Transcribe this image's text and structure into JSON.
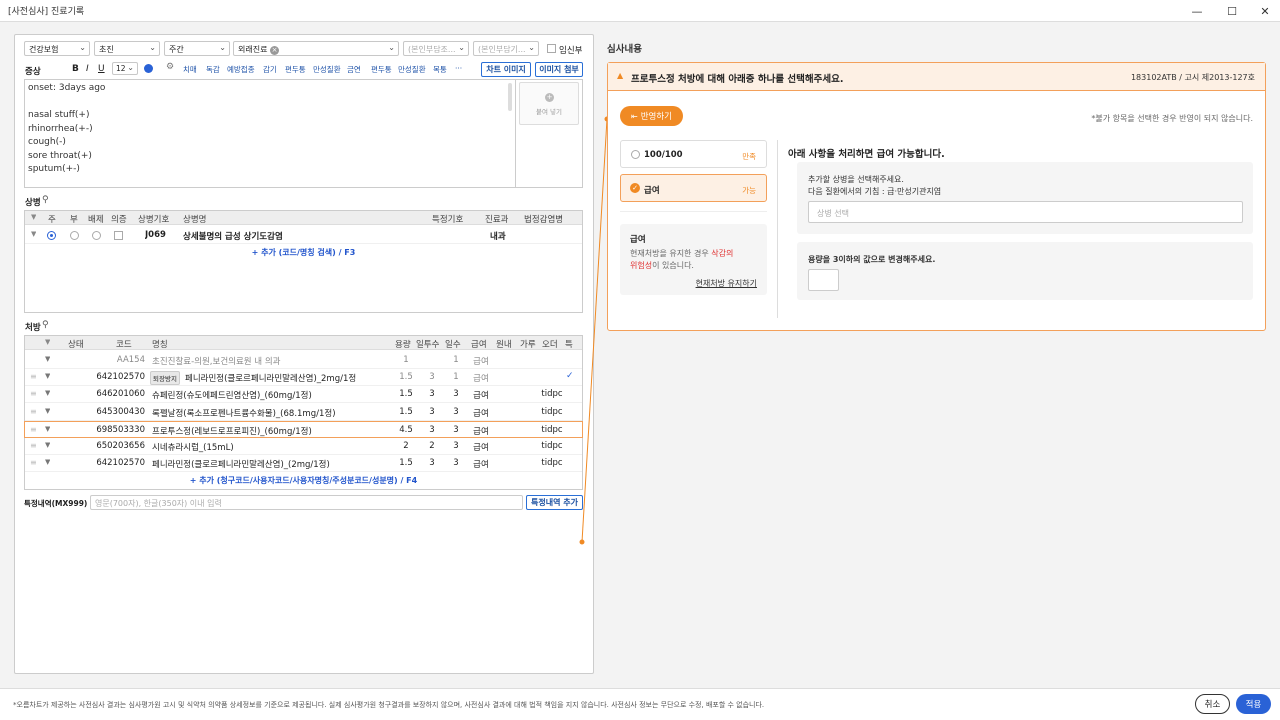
{
  "window": {
    "title": "[사전심사] 진료기록"
  },
  "top_selects": {
    "insurance": "건강보험",
    "visit_type": "초진",
    "time": "주간",
    "care_type": "외래진료",
    "copay1_placeholder": "(본인부담조...",
    "copay2_placeholder": "(본인부담기...",
    "pregnant_label": "임신부"
  },
  "symptom": {
    "label": "증상",
    "font_size": "12",
    "quick_tags": [
      "치매",
      "독감",
      "예방접종",
      "감기",
      "편두통",
      "만성질환",
      "금연",
      "편두통",
      "만성질환",
      "복통",
      "···"
    ],
    "chart_image_btn": "차트 이미지",
    "image_attach_btn": "이미지 첨부",
    "paste_label": "붙여 넣기",
    "text_lines": [
      "onset: 3days ago",
      "",
      "nasal stuff(+)",
      "rhinorrhea(+-)",
      "cough(-)",
      "sore throat(+)",
      "sputum(+-)"
    ]
  },
  "diagnosis": {
    "label": "상병",
    "headers": {
      "main": "주",
      "sub": "부",
      "exclude": "배제",
      "suspect": "의증",
      "code": "상병기호",
      "name": "상병명",
      "special": "특정기호",
      "dept": "진료과",
      "legal": "법정감염병"
    },
    "rows": [
      {
        "code": "J069",
        "name": "상세불명의 급성 상기도감염",
        "dept": "내과"
      }
    ],
    "add_link": "+ 추가 (코드/명칭 검색) / F3"
  },
  "prescription": {
    "label": "처방",
    "headers": {
      "status": "상태",
      "code": "코드",
      "name": "명칭",
      "dose": "용량",
      "times": "일투수",
      "days": "일수",
      "pay": "급여",
      "inout": "원내",
      "powder": "가루",
      "order": "오더",
      "special": "특"
    },
    "rows": [
      {
        "code": "AA154",
        "name": "초진진찰료-의원,보건의료원 내 의과",
        "dose": "1",
        "times": "",
        "days": "1",
        "pay": "급여",
        "order": "",
        "tag": "",
        "grey": true,
        "check": false,
        "highlight": false
      },
      {
        "code": "642102570",
        "name": "페니라민정(클로르페니라민말레산염)_2mg/1정",
        "dose": "1.5",
        "times": "3",
        "days": "1",
        "pay": "급여",
        "order": "",
        "tag": "퇴장방지",
        "grey": false,
        "check": true,
        "highlight": false,
        "greyvals": true
      },
      {
        "code": "646201060",
        "name": "슈페린정(슈도에페드린염산염)_(60mg/1정)",
        "dose": "1.5",
        "times": "3",
        "days": "3",
        "pay": "급여",
        "order": "tidpc",
        "tag": "",
        "grey": false,
        "check": false,
        "highlight": false
      },
      {
        "code": "645300430",
        "name": "록펠날정(록소프로펜나트륨수화물)_(68.1mg/1정)",
        "dose": "1.5",
        "times": "3",
        "days": "3",
        "pay": "급여",
        "order": "tidpc",
        "tag": "",
        "grey": false,
        "check": false,
        "highlight": false
      },
      {
        "code": "698503330",
        "name": "프로투스정(레보드로프로피진)_(60mg/1정)",
        "dose": "4.5",
        "times": "3",
        "days": "3",
        "pay": "급여",
        "order": "tidpc",
        "tag": "",
        "grey": false,
        "check": false,
        "highlight": true
      },
      {
        "code": "650203656",
        "name": "시네츄라시럽_(15mL)",
        "dose": "2",
        "times": "2",
        "days": "3",
        "pay": "급여",
        "order": "tidpc",
        "tag": "",
        "grey": false,
        "check": false,
        "highlight": false
      },
      {
        "code": "642102570",
        "name": "페니라민정(클로르페니라민말레산염)_(2mg/1정)",
        "dose": "1.5",
        "times": "3",
        "days": "3",
        "pay": "급여",
        "order": "tidpc",
        "tag": "",
        "grey": false,
        "check": false,
        "highlight": false
      }
    ],
    "add_link": "+ 추가 (청구코드/사용자코드/사용자명칭/주성분코드/성분명) / F4"
  },
  "special_record": {
    "label": "특정내역(MX999)",
    "placeholder": "영문(700자), 한글(350자) 이내 입력",
    "add_btn": "특정내역 추가"
  },
  "review": {
    "title": "심사내용",
    "banner_text": "프로투스정 처방에 대해 아래중 하나를 선택해주세요.",
    "banner_code": "183102ATB / 고시 제2013-127호",
    "apply_btn": "반영하기",
    "note": "*불가 항목을 선택한 경우 반영이 되지 않습니다.",
    "options": [
      {
        "label": "100/100",
        "status": "만족"
      },
      {
        "label": "급여",
        "status": "가능"
      }
    ],
    "info_box": {
      "title": "급여",
      "text1": "현재처방을 유지한 경우 ",
      "text_red1": "삭감의",
      "text_red2": "위험성",
      "text2": "이 있습니다.",
      "link": "현재처방 유지하기"
    },
    "right_title": "아래 사항을 처리하면 급여 가능합니다.",
    "req1_line1": "추가할 상병을 선택해주세요.",
    "req1_line2": "다음 질환에서의 기침 : 급·만성기관지염",
    "req1_placeholder": "상병 선택",
    "req2_text": "용량을 3이하의 값으로 변경해주세요.",
    "accent": "#f08a24"
  },
  "footer": {
    "disclaimer": "*오름차트가 제공하는 사전심사 결과는 심사평가원 고시 및 식약처 의약품 상세정보를 기준으로 제공됩니다. 실제 심사평가원 청구결과를 보장하지 않으며, 사전심사 결과에 대해 법적 책임을 지지 않습니다. 사전심사 정보는 무단으로 수정, 배포할 수 없습니다.",
    "cancel": "취소",
    "apply": "적용"
  }
}
